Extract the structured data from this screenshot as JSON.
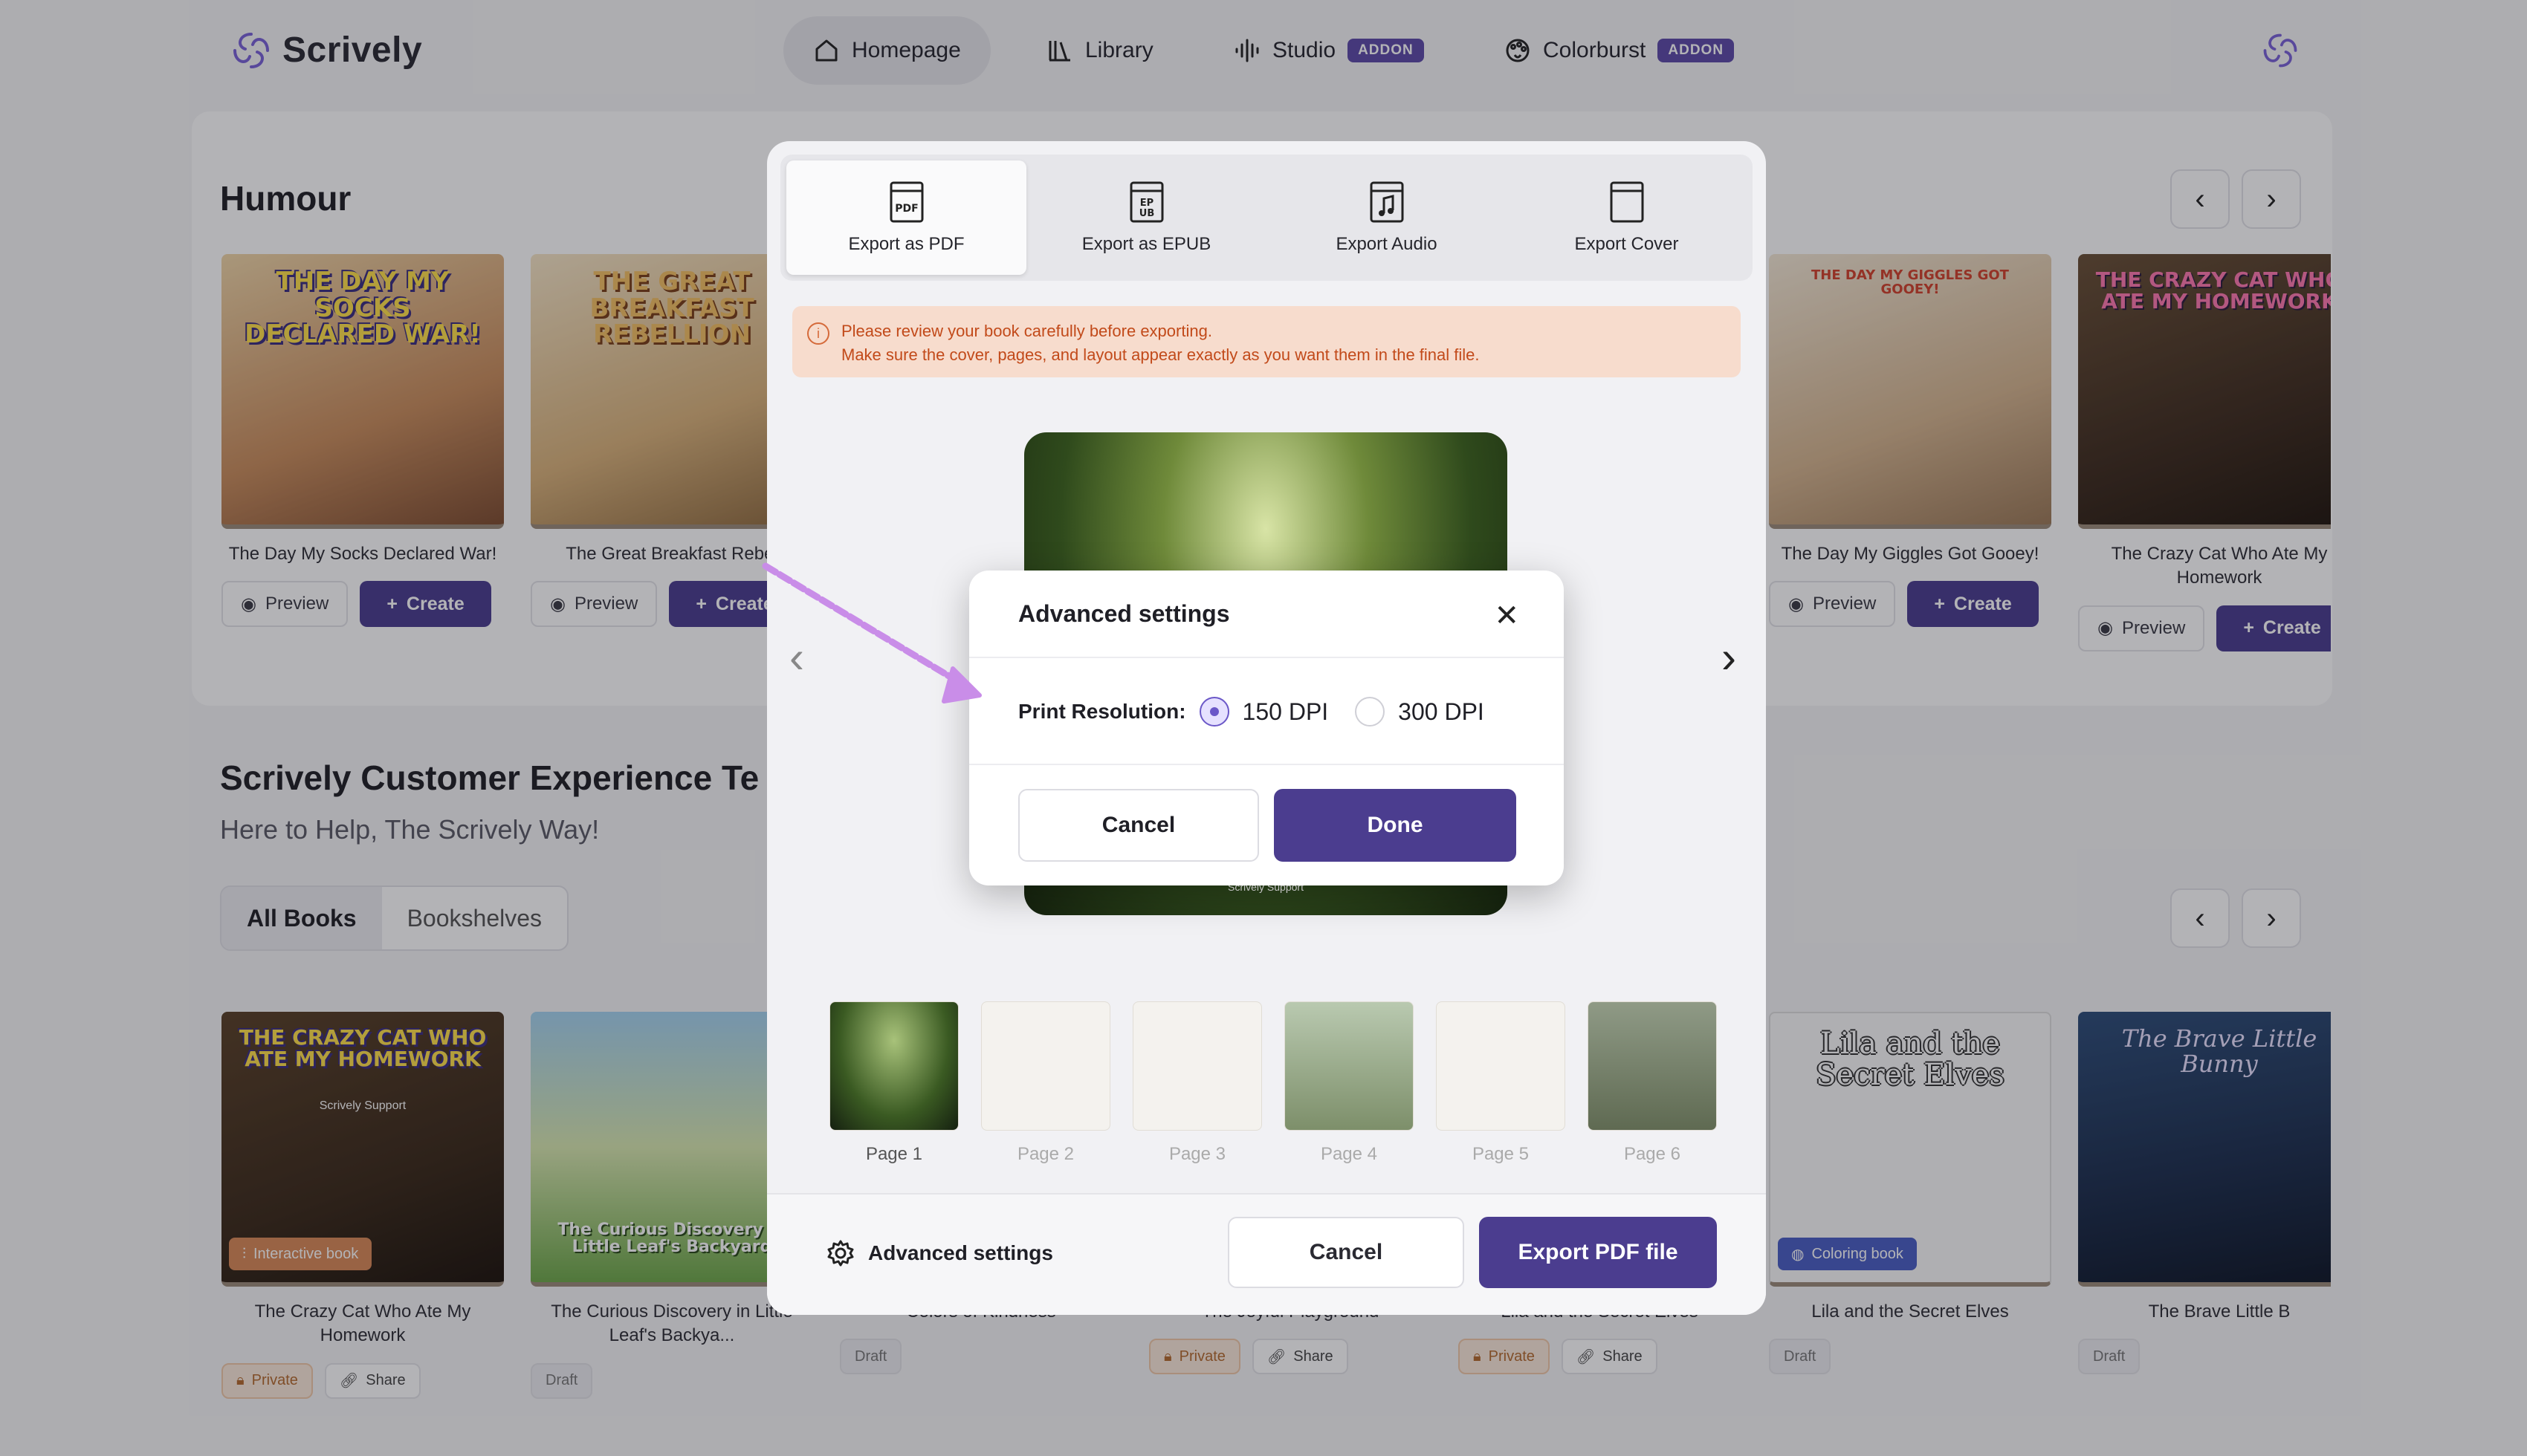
{
  "app": {
    "name": "Scrively"
  },
  "nav": {
    "items": [
      {
        "label": "Homepage",
        "icon": "home-icon"
      },
      {
        "label": "Library",
        "icon": "library-icon"
      },
      {
        "label": "Studio",
        "icon": "audio-wave-icon",
        "badge": "ADDON"
      },
      {
        "label": "Colorburst",
        "icon": "palette-icon",
        "badge": "ADDON"
      }
    ]
  },
  "humour": {
    "title": "Humour",
    "books": [
      {
        "title": "The Day My Socks Declared War!",
        "cover_text": "THE DAY MY SOCKS DECLARED WAR!"
      },
      {
        "title": "The Great Breakfast Rebel",
        "cover_text": "THE GREAT BREAKFAST REBELLION"
      },
      {
        "title": "The Day My Giggles Got Gooey!",
        "cover_text": "THE DAY MY GIGGLES GOT GOOEY!"
      },
      {
        "title": "The Crazy Cat Who Ate My Homework",
        "cover_text": "THE CRAZY CAT WHO ATE MY HOMEWORK"
      }
    ],
    "preview_label": "Preview",
    "create_label": "Create"
  },
  "team": {
    "title": "Scrively Customer Experience Te",
    "subtitle": "Here to Help, The Scrively Way!",
    "tabs": [
      "All Books",
      "Bookshelves"
    ],
    "books": [
      {
        "title": "The Crazy Cat Who Ate My Homework",
        "cover_text": "THE CRAZY CAT WHO ATE MY HOMEWORK",
        "cover_sub": "Scrively Support",
        "badge": "Interactive book",
        "tags": [
          "Private",
          "Share"
        ]
      },
      {
        "title": "The Curious Discovery in Little Leaf's Backya...",
        "cover_text": "The Curious Discovery in Little Leaf's Backyard",
        "tags": [
          "Draft"
        ]
      },
      {
        "title": "Colors of Kindness",
        "tags": [
          "Draft"
        ]
      },
      {
        "title": "The Joyful Playground",
        "tags": [
          "Private",
          "Share"
        ]
      },
      {
        "title": "Lila and the Secret Elves",
        "tags": [
          "Private",
          "Share"
        ]
      },
      {
        "title": "Lila and the Secret Elves",
        "cover_text": "Lila and the Secret Elves",
        "badge": "Coloring book",
        "tags": [
          "Draft"
        ]
      },
      {
        "title": "The Brave Little B",
        "cover_text": "The Brave Little Bunny",
        "tags": [
          "Draft"
        ]
      }
    ]
  },
  "export_modal": {
    "tabs": [
      {
        "label": "Export as PDF",
        "icon": "pdf-file-icon"
      },
      {
        "label": "Export as EPUB",
        "icon": "epub-file-icon"
      },
      {
        "label": "Export Audio",
        "icon": "audio-file-icon"
      },
      {
        "label": "Export Cover",
        "icon": "cover-page-icon"
      }
    ],
    "warning_line1": "Please review your book carefully before exporting.",
    "warning_line2": "Make sure the cover, pages, and layout appear exactly as you want them in the final file.",
    "preview_footer": "Scrively Support",
    "pages": [
      "Page 1",
      "Page 2",
      "Page 3",
      "Page 4",
      "Page 5",
      "Page 6"
    ],
    "advanced_label": "Advanced settings",
    "cancel_label": "Cancel",
    "export_label": "Export PDF file"
  },
  "advanced_dialog": {
    "title": "Advanced settings",
    "resolution_label": "Print Resolution:",
    "options": [
      "150 DPI",
      "300 DPI"
    ],
    "selected": "150 DPI",
    "cancel_label": "Cancel",
    "done_label": "Done"
  },
  "colors": {
    "brand": "#4b3d8f",
    "addon": "#5e4aa8",
    "warning_bg": "#f7dccd",
    "warning_text": "#c24a1a",
    "annotation_arrow": "#c98de8"
  }
}
